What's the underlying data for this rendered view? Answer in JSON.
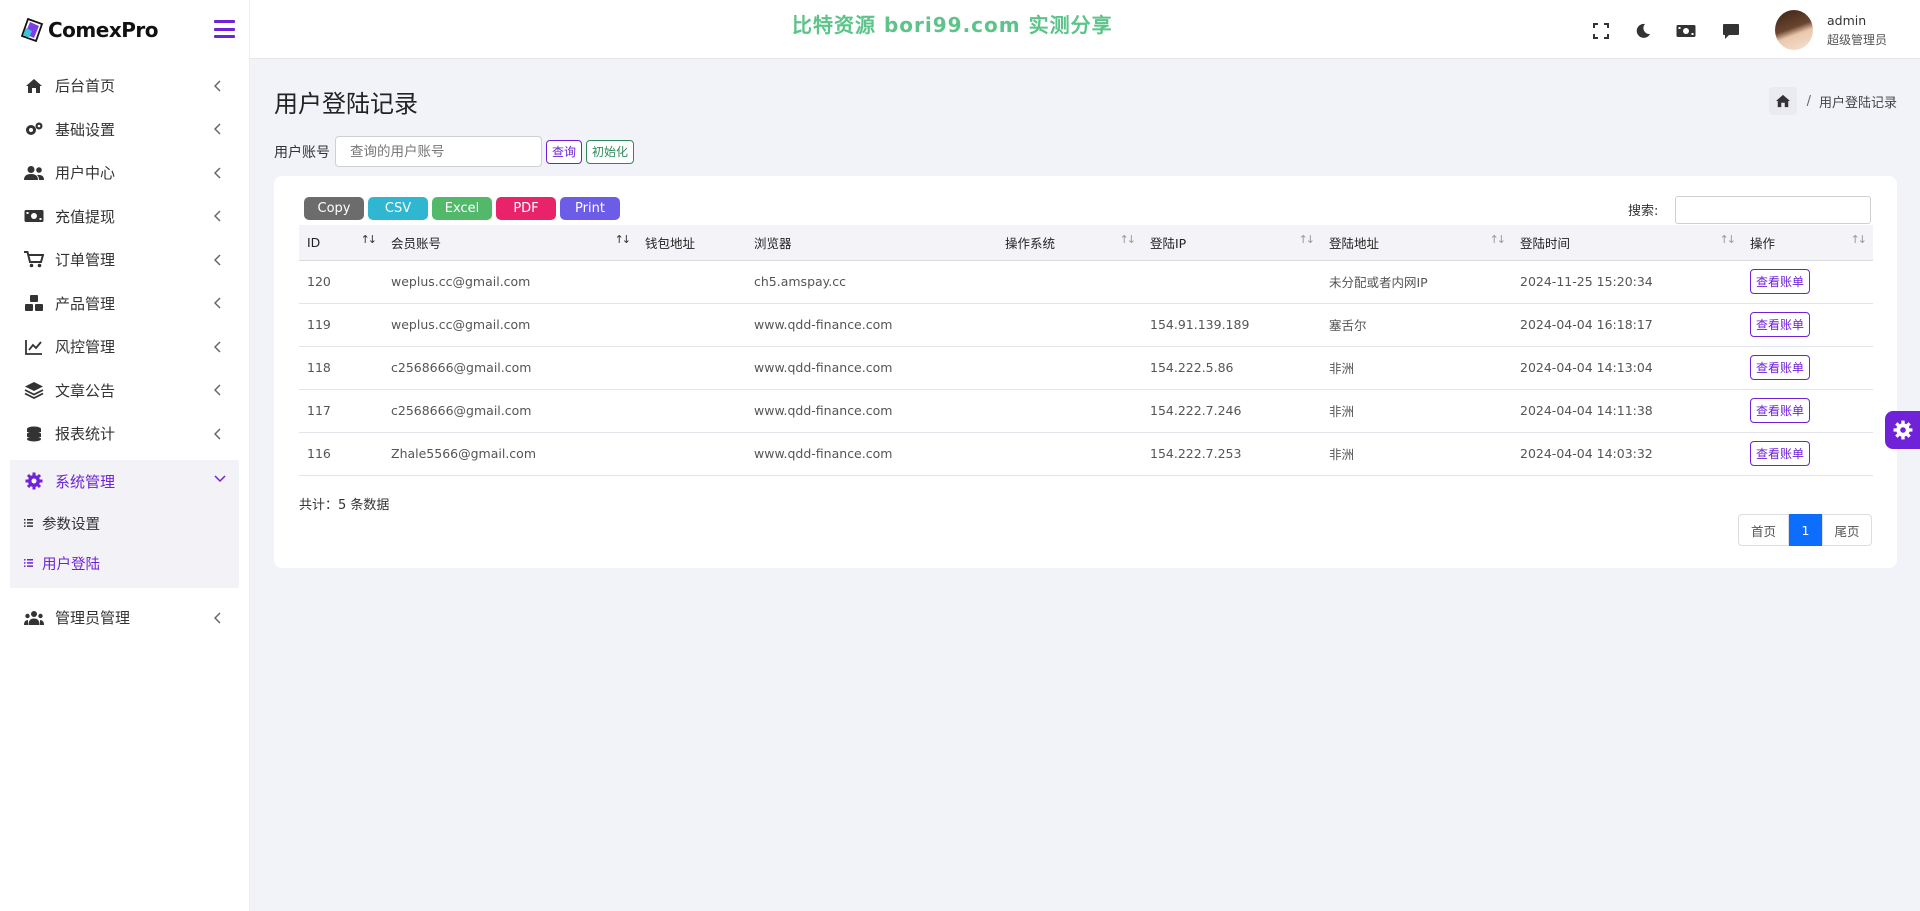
{
  "brand": {
    "name": "ComexPro"
  },
  "header": {
    "watermark": "比特资源 bori99.com 实测分享",
    "user": {
      "name": "admin",
      "role": "超级管理员"
    }
  },
  "sidebar": {
    "items": [
      {
        "label": "后台首页",
        "icon": "home-icon"
      },
      {
        "label": "基础设置",
        "icon": "gears-icon"
      },
      {
        "label": "用户中心",
        "icon": "users-icon"
      },
      {
        "label": "充值提现",
        "icon": "money-icon"
      },
      {
        "label": "订单管理",
        "icon": "cart-icon"
      },
      {
        "label": "产品管理",
        "icon": "cubes-icon"
      },
      {
        "label": "风控管理",
        "icon": "line-chart-icon"
      },
      {
        "label": "文章公告",
        "icon": "layers-icon"
      },
      {
        "label": "报表统计",
        "icon": "coins-icon"
      }
    ],
    "active_group": {
      "label": "系统管理",
      "icon": "gear-icon",
      "children": [
        {
          "label": "参数设置",
          "active": false
        },
        {
          "label": "用户登陆",
          "active": true
        }
      ]
    },
    "last_item": {
      "label": "管理员管理",
      "icon": "user-group-icon"
    }
  },
  "page": {
    "title": "用户登陆记录",
    "breadcrumb": {
      "separator": "/",
      "current": "用户登陆记录"
    }
  },
  "filter": {
    "label": "用户账号",
    "placeholder": "查询的用户账号",
    "query_label": "查询",
    "reset_label": "初始化"
  },
  "export": {
    "buttons": [
      {
        "label": "Copy",
        "color": "#6c6c6c"
      },
      {
        "label": "CSV",
        "color": "#2fb6d1"
      },
      {
        "label": "Excel",
        "color": "#52b96b"
      },
      {
        "label": "PDF",
        "color": "#e9236a"
      },
      {
        "label": "Print",
        "color": "#6c5ce7"
      }
    ]
  },
  "search": {
    "label": "搜索:"
  },
  "table": {
    "columns": [
      "ID",
      "会员账号",
      "钱包地址",
      "浏览器",
      "操作系统",
      "登陆IP",
      "登陆地址",
      "登陆时间",
      "操作"
    ],
    "rows": [
      {
        "id": "120",
        "account": "weplus.cc@gmail.com",
        "wallet": "",
        "browser": "ch5.amspay.cc",
        "os": "",
        "ip": "",
        "location": "未分配或者内网IP",
        "time": "2024-11-25 15:20:34",
        "action": "查看账单"
      },
      {
        "id": "119",
        "account": "weplus.cc@gmail.com",
        "wallet": "",
        "browser": "www.qdd-finance.com",
        "os": "",
        "ip": "154.91.139.189",
        "location": "塞舌尔",
        "time": "2024-04-04 16:18:17",
        "action": "查看账单"
      },
      {
        "id": "118",
        "account": "c2568666@gmail.com",
        "wallet": "",
        "browser": "www.qdd-finance.com",
        "os": "",
        "ip": "154.222.5.86",
        "location": "非洲",
        "time": "2024-04-04 14:13:04",
        "action": "查看账单"
      },
      {
        "id": "117",
        "account": "c2568666@gmail.com",
        "wallet": "",
        "browser": "www.qdd-finance.com",
        "os": "",
        "ip": "154.222.7.246",
        "location": "非洲",
        "time": "2024-04-04 14:11:38",
        "action": "查看账单"
      },
      {
        "id": "116",
        "account": "Zhale5566@gmail.com",
        "wallet": "",
        "browser": "www.qdd-finance.com",
        "os": "",
        "ip": "154.222.7.253",
        "location": "非洲",
        "time": "2024-04-04 14:03:32",
        "action": "查看账单"
      }
    ]
  },
  "summary": {
    "total": "共计：5 条数据"
  },
  "pagination": {
    "first": "首页",
    "current": "1",
    "last": "尾页"
  },
  "colors": {
    "accent": "#6f22d8",
    "primary": "#0d6efd",
    "watermark": "#5cc38a"
  }
}
